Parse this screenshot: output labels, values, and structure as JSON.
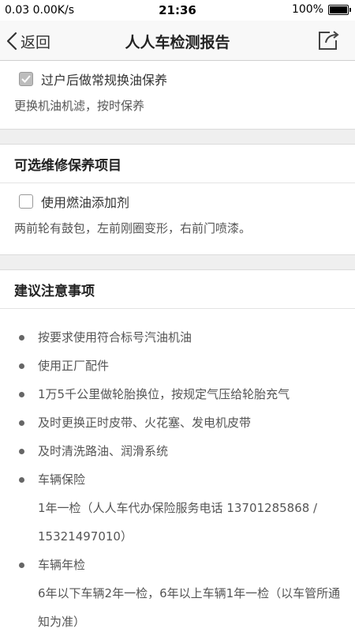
{
  "status_bar": {
    "left": "0.03 0.00K/s",
    "time": "21:36",
    "battery": "100%"
  },
  "nav": {
    "back_label": "返回",
    "title": "人人车检测报告"
  },
  "sections": {
    "top_item": {
      "label": "过户后做常规换油保养",
      "checked": true,
      "description": "更换机油机滤，按时保养"
    },
    "optional": {
      "title": "可选维修保养项目",
      "item_label": "使用燃油添加剂",
      "item_checked": false,
      "description": "两前轮有鼓包，左前刚圈变形，右前门喷漆。"
    },
    "advice": {
      "title": "建议注意事项",
      "tips": [
        {
          "text": "按要求使用符合标号汽油机油"
        },
        {
          "text": "使用正厂配件"
        },
        {
          "text": "1万5千公里做轮胎换位，按规定气压给轮胎充气"
        },
        {
          "text": "及时更换正时皮带、火花塞、发电机皮带"
        },
        {
          "text": "及时清洗路油、润滑系统"
        },
        {
          "text": "车辆保险",
          "sub": "1年一检（人人车代办保险服务电话 13701285868 / 15321497010）"
        },
        {
          "text": "车辆年检",
          "sub": "6年以下车辆2年一检，6年以上车辆1年一检（以车管所通知为准）"
        }
      ]
    }
  }
}
